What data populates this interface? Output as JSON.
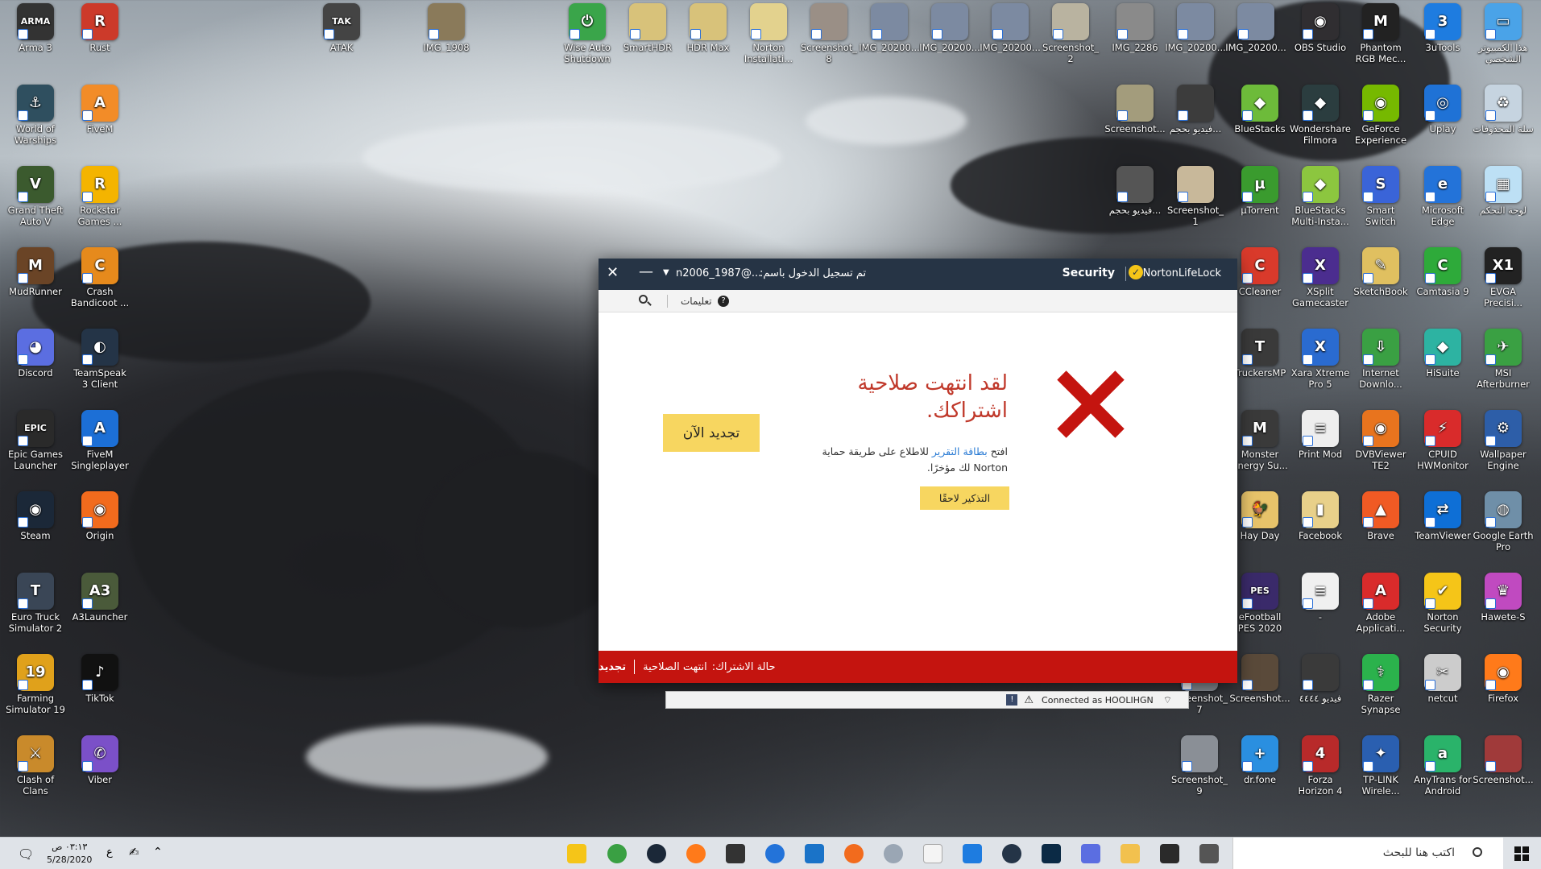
{
  "desktop_icons": [
    {
      "label": "Arma 3",
      "color": "#333333",
      "glyph": "ARMA"
    },
    {
      "label": "Rust",
      "color": "#cc3a2a",
      "glyph": "R"
    },
    {
      "label": "ATAK",
      "color": "#444444",
      "glyph": "TAK"
    },
    {
      "label": "IMG_1908",
      "color": "#8a7a5a",
      "glyph": ""
    },
    {
      "label": "Wise Auto Shutdown",
      "color": "#3aa54a",
      "glyph": "⏻"
    },
    {
      "label": "SmartHDR",
      "color": "#d8c27a",
      "glyph": ""
    },
    {
      "label": "HDR Max",
      "color": "#d8c27a",
      "glyph": ""
    },
    {
      "label": "Norton Installati...",
      "color": "#e3d28e",
      "glyph": ""
    },
    {
      "label": "Screenshot_8",
      "color": "#9a8f86",
      "glyph": ""
    },
    {
      "label": "IMG_20200...",
      "color": "#7c8aa1",
      "glyph": ""
    },
    {
      "label": "IMG_20200...",
      "color": "#7c8aa1",
      "glyph": ""
    },
    {
      "label": "IMG_20200...",
      "color": "#7c8aa1",
      "glyph": ""
    },
    {
      "label": "Screenshot_2",
      "color": "#b9b3a0",
      "glyph": ""
    },
    {
      "label": "IMG_2286",
      "color": "#8a8a8a",
      "glyph": ""
    },
    {
      "label": "IMG_20200...",
      "color": "#7c8aa1",
      "glyph": ""
    },
    {
      "label": "IMG_20200...",
      "color": "#7c8aa1",
      "glyph": ""
    },
    {
      "label": "OBS Studio",
      "color": "#302e31",
      "glyph": "◉"
    },
    {
      "label": "Phantom RGB Mec...",
      "color": "#222222",
      "glyph": "M"
    },
    {
      "label": "3uTools",
      "color": "#1e7ce0",
      "glyph": "3"
    },
    {
      "label": "هذا الكمبيوتر الشخصي",
      "color": "#4aa3e8",
      "glyph": "▭"
    },
    {
      "label": "World of Warships",
      "color": "#2f4f5f",
      "glyph": "⚓"
    },
    {
      "label": "FiveM",
      "color": "#f28c28",
      "glyph": "A"
    },
    {
      "label": "Screenshot...",
      "color": "#a39c7c",
      "glyph": ""
    },
    {
      "label": "فيديو بحجم...",
      "color": "#3c3c3c",
      "glyph": ""
    },
    {
      "label": "BlueStacks",
      "color": "#6dbb3a",
      "glyph": "◆"
    },
    {
      "label": "Wondershare Filmora",
      "color": "#2b3d3f",
      "glyph": "◆"
    },
    {
      "label": "GeForce Experience",
      "color": "#76b900",
      "glyph": "◉"
    },
    {
      "label": "Uplay",
      "color": "#1f72d6",
      "glyph": "◎"
    },
    {
      "label": "سلة المحذوفات",
      "color": "#c6d4e0",
      "glyph": "♻"
    },
    {
      "label": "Grand Theft Auto V",
      "color": "#3b5a2e",
      "glyph": "V"
    },
    {
      "label": "Rockstar Games ...",
      "color": "#f4b400",
      "glyph": "R"
    },
    {
      "label": "فيديو بحجم...",
      "color": "#555555",
      "glyph": ""
    },
    {
      "label": "Screenshot_1",
      "color": "#c8b89a",
      "glyph": ""
    },
    {
      "label": "µTorrent",
      "color": "#3a9b2e",
      "glyph": "µ"
    },
    {
      "label": "BlueStacks Multi-Insta...",
      "color": "#8cc63f",
      "glyph": "◆"
    },
    {
      "label": "Smart Switch",
      "color": "#3a64d8",
      "glyph": "S"
    },
    {
      "label": "Microsoft Edge",
      "color": "#2373d9",
      "glyph": "e"
    },
    {
      "label": "لوحة التحكم",
      "color": "#bde0f5",
      "glyph": "▦"
    },
    {
      "label": "MudRunner",
      "color": "#6a4426",
      "glyph": "M"
    },
    {
      "label": "Crash Bandicoot ...",
      "color": "#e68a1c",
      "glyph": "C"
    },
    {
      "label": "CCleaner",
      "color": "#d93a2b",
      "glyph": "C"
    },
    {
      "label": "XSplit Gamecaster",
      "color": "#4b2d8f",
      "glyph": "X"
    },
    {
      "label": "SketchBook",
      "color": "#e0c060",
      "glyph": "✎"
    },
    {
      "label": "Camtasia 9",
      "color": "#2eaa3a",
      "glyph": "C"
    },
    {
      "label": "EVGA Precisi...",
      "color": "#222222",
      "glyph": "X1"
    },
    {
      "label": "Discord",
      "color": "#5b6ee1",
      "glyph": "◕"
    },
    {
      "label": "TeamSpeak 3 Client",
      "color": "#243447",
      "glyph": "◐"
    },
    {
      "label": "TruckersMP",
      "color": "#3a3a3a",
      "glyph": "T"
    },
    {
      "label": "Xara Xtreme Pro 5",
      "color": "#2a6bd0",
      "glyph": "X"
    },
    {
      "label": "Internet Downlo...",
      "color": "#3aa043",
      "glyph": "⇩"
    },
    {
      "label": "HiSuite",
      "color": "#2db3a2",
      "glyph": "◆"
    },
    {
      "label": "MSI Afterburner",
      "color": "#3aa043",
      "glyph": "✈"
    },
    {
      "label": "Epic Games Launcher",
      "color": "#2a2a2a",
      "glyph": "EPIC"
    },
    {
      "label": "FiveM Singleplayer",
      "color": "#1c6fd6",
      "glyph": "A"
    },
    {
      "label": "Monster Energy Su...",
      "color": "#3a3a3a",
      "glyph": "M"
    },
    {
      "label": "Print Mod",
      "color": "#eeeeee",
      "glyph": "≡"
    },
    {
      "label": "DVBViewer TE2",
      "color": "#e8741e",
      "glyph": "◉"
    },
    {
      "label": "CPUID HWMonitor",
      "color": "#d92b2b",
      "glyph": "⚡"
    },
    {
      "label": "Wallpaper Engine",
      "color": "#2d5ea8",
      "glyph": "⚙"
    },
    {
      "label": "Steam",
      "color": "#1b2838",
      "glyph": "◉"
    },
    {
      "label": "Origin",
      "color": "#f26b1d",
      "glyph": "◉"
    },
    {
      "label": "Hay Day",
      "color": "#e7c36a",
      "glyph": "🐓"
    },
    {
      "label": "Facebook",
      "color": "#e8d08a",
      "glyph": "▮"
    },
    {
      "label": "Brave",
      "color": "#f05a24",
      "glyph": "▲"
    },
    {
      "label": "TeamViewer",
      "color": "#0e6fd6",
      "glyph": "⇄"
    },
    {
      "label": "Google Earth Pro",
      "color": "#6f8fa8",
      "glyph": "◍"
    },
    {
      "label": "Euro Truck Simulator 2",
      "color": "#3a4656",
      "glyph": "T"
    },
    {
      "label": "A3Launcher",
      "color": "#4a5a3a",
      "glyph": "A3"
    },
    {
      "label": "eFootball PES 2020",
      "color": "#3a2a6a",
      "glyph": "PES"
    },
    {
      "label": "-",
      "color": "#f0f0f0",
      "glyph": "≡"
    },
    {
      "label": "Adobe Applicati...",
      "color": "#d92b2b",
      "glyph": "A"
    },
    {
      "label": "Norton Security",
      "color": "#f5c518",
      "glyph": "✔"
    },
    {
      "label": "Hawete-S",
      "color": "#c04ac0",
      "glyph": "♛"
    },
    {
      "label": "Farming Simulator 19",
      "color": "#e0a11b",
      "glyph": "19"
    },
    {
      "label": "TikTok",
      "color": "#111111",
      "glyph": "♪"
    },
    {
      "label": "Screenshot_7",
      "color": "#8a8f96",
      "glyph": ""
    },
    {
      "label": "Screenshot...",
      "color": "#5a4a3a",
      "glyph": ""
    },
    {
      "label": "فيديو ٤٤٤٤",
      "color": "#3a3a3a",
      "glyph": ""
    },
    {
      "label": "Razer Synapse",
      "color": "#2bb24c",
      "glyph": "⚕"
    },
    {
      "label": "netcut",
      "color": "#cccccc",
      "glyph": "✂"
    },
    {
      "label": "Firefox",
      "color": "#ff7a1a",
      "glyph": "◉"
    },
    {
      "label": "Clash of Clans",
      "color": "#c98a2b",
      "glyph": "⚔"
    },
    {
      "label": "Viber",
      "color": "#7b50c8",
      "glyph": "✆"
    },
    {
      "label": "Screenshot_9",
      "color": "#8a8f96",
      "glyph": ""
    },
    {
      "label": "dr.fone",
      "color": "#2a8fe0",
      "glyph": "+"
    },
    {
      "label": "Forza Horizon 4",
      "color": "#b82a2a",
      "glyph": "4"
    },
    {
      "label": "TP-LINK Wirele...",
      "color": "#2a5fb0",
      "glyph": "✦"
    },
    {
      "label": "AnyTrans for Android",
      "color": "#2ab36a",
      "glyph": "a"
    },
    {
      "label": "Screenshot...",
      "color": "#a03a3a",
      "glyph": ""
    }
  ],
  "norton": {
    "brand": "NortonLifeLock",
    "product": "Security",
    "logged_in_label": "تم تسجيل الدخول باسم:",
    "account": "n2006_1987@...",
    "help": "تعليمات",
    "heading_line1": "لقد انتهت صلاحية",
    "heading_line2": "اشتراكك.",
    "body_open": "افتح",
    "body_link": "بطاقة التقرير",
    "body_rest": "للاطلاع على طريقة حماية",
    "body_line2": "Norton لك مؤخرًا.",
    "remind_button": "التذكير لاحقًا",
    "renew_button": "تجديد الآن",
    "status_label": "حالة الاشتراك:",
    "status_value": "انتهت الصلاحية",
    "status_action": "تجديد"
  },
  "vpn": {
    "connected": "Connected as HOOLIHGN"
  },
  "taskbar": {
    "search_placeholder": "اكتب هنا للبحث",
    "time": "٠٣:١٣ ص",
    "date": "5/28/2020",
    "lang": "ع"
  }
}
